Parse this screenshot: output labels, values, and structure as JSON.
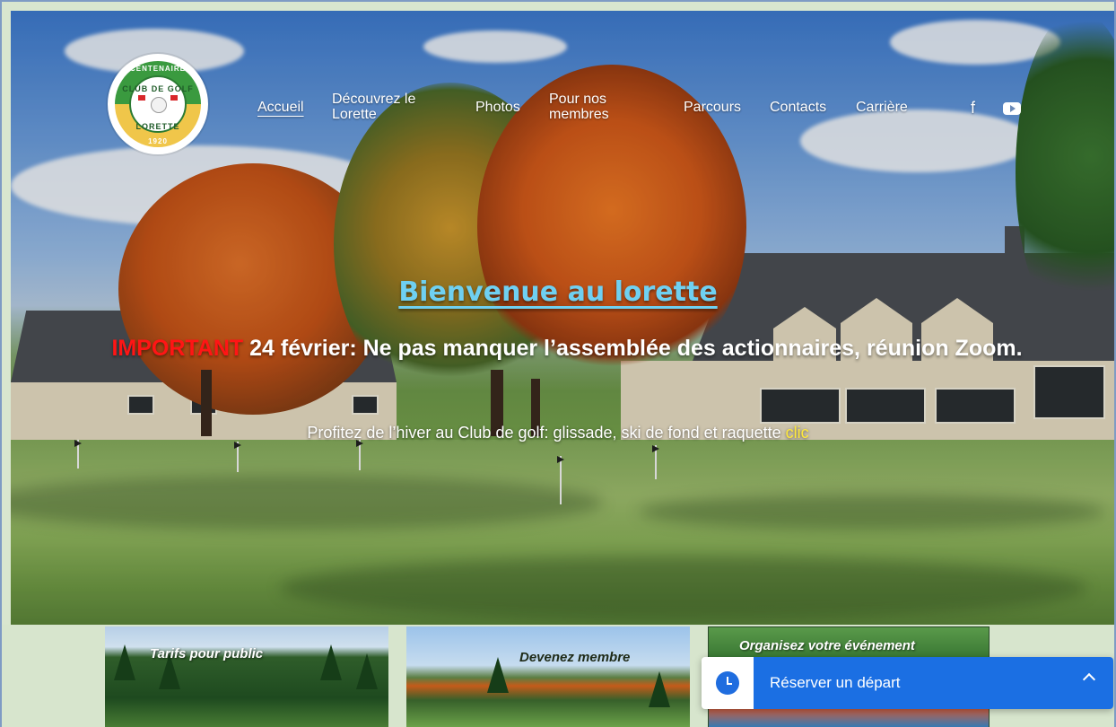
{
  "nav": {
    "items": [
      {
        "label": "Accueil",
        "active": true
      },
      {
        "label": "Découvrez le Lorette",
        "active": false
      },
      {
        "label": "Photos",
        "active": false
      },
      {
        "label": "Pour nos membres",
        "active": false
      },
      {
        "label": "Parcours",
        "active": false
      },
      {
        "label": "Contacts",
        "active": false
      },
      {
        "label": "Carrière",
        "active": false
      }
    ],
    "social": {
      "facebook": "f",
      "youtube": "youtube-icon"
    }
  },
  "logo": {
    "top": "CENTENAIRE",
    "middle": "CLUB DE GOLF",
    "bottom": "LORETTE",
    "year": "1920"
  },
  "hero": {
    "title": "Bienvenue au lorette",
    "important_label": "IMPORTANT",
    "announcement": " 24 février: Ne pas manquer l’assemblée des actionnaires, réunion Zoom.",
    "winter_text": "Profitez de l’hiver au Club de golf: glissade, ski de fond et raquette ",
    "winter_link": "clic"
  },
  "cards": [
    {
      "title": "Tarifs pour public"
    },
    {
      "title": "Devenez  membre"
    },
    {
      "title": "Organisez votre événement"
    }
  ],
  "booking": {
    "label": "Réserver un départ",
    "accent": "#1b6fe3"
  }
}
